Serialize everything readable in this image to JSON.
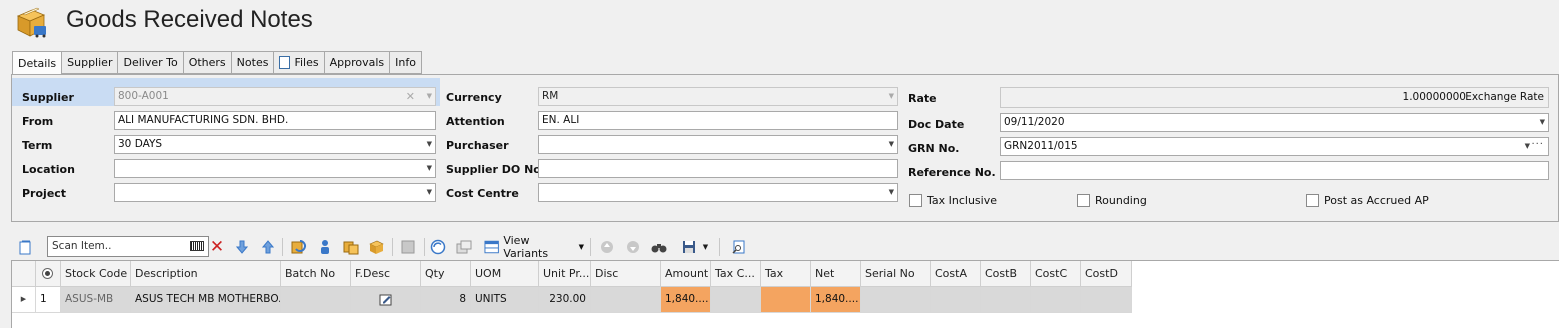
{
  "window": {
    "title": "Goods Received Notes",
    "icon": "box-icon"
  },
  "tabs": [
    {
      "label": "Details",
      "active": true
    },
    {
      "label": "Supplier"
    },
    {
      "label": "Deliver To"
    },
    {
      "label": "Others"
    },
    {
      "label": "Notes"
    },
    {
      "label": "Files",
      "icon": "file-icon"
    },
    {
      "label": "Approvals"
    },
    {
      "label": "Info"
    }
  ],
  "form": {
    "supplier": {
      "label": "Supplier",
      "value": "800-A001"
    },
    "from": {
      "label": "From",
      "value": "ALI MANUFACTURING SDN. BHD."
    },
    "term": {
      "label": "Term",
      "value": "30 DAYS"
    },
    "location": {
      "label": "Location",
      "value": ""
    },
    "project": {
      "label": "Project",
      "value": ""
    },
    "currency": {
      "label": "Currency",
      "value": "RM"
    },
    "attention": {
      "label": "Attention",
      "value": "EN. ALI"
    },
    "purchaser": {
      "label": "Purchaser",
      "value": ""
    },
    "supplier_do": {
      "label": "Supplier DO No",
      "value": ""
    },
    "cost_centre": {
      "label": "Cost Centre",
      "value": ""
    },
    "rate": {
      "label": "Rate",
      "value": "1.00000000",
      "unit": "Exchange Rate"
    },
    "doc_date": {
      "label": "Doc Date",
      "value": "09/11/2020"
    },
    "grn_no": {
      "label": "GRN No.",
      "value": "GRN2011/015"
    },
    "reference": {
      "label": "Reference No.",
      "value": ""
    },
    "tax_inclusive": {
      "label": "Tax Inclusive",
      "checked": false
    },
    "rounding": {
      "label": "Rounding",
      "checked": false
    },
    "post_accrued": {
      "label": "Post as Accrued AP",
      "checked": false
    }
  },
  "toolbar": {
    "scan_placeholder": "Scan Item..",
    "view_variants": "View Variants"
  },
  "colors": {
    "highlight": "#c9dcf3",
    "amount_cell": "#f4a460",
    "delete_icon": "#cc2222",
    "arrow_icon": "#3a78c8"
  },
  "grid": {
    "columns": [
      "Stock Code",
      "Description",
      "Batch No",
      "F.Desc",
      "Qty",
      "UOM",
      "Unit Pr...",
      "Disc",
      "Amount",
      "Tax C...",
      "Tax",
      "Net",
      "Serial No",
      "CostA",
      "CostB",
      "CostC",
      "CostD"
    ],
    "rows": [
      {
        "seq": "1",
        "stock_code": "ASUS-MB",
        "description": "ASUS TECH MB MOTHERBO...",
        "batch_no": "",
        "qty": "8",
        "uom": "UNITS",
        "unit_price": "230.00",
        "disc": "",
        "amount": "1,840....",
        "tax_code": "",
        "tax": "",
        "net": "1,840....",
        "serial_no": "",
        "cost_a": "",
        "cost_b": "",
        "cost_c": "",
        "cost_d": ""
      }
    ]
  }
}
